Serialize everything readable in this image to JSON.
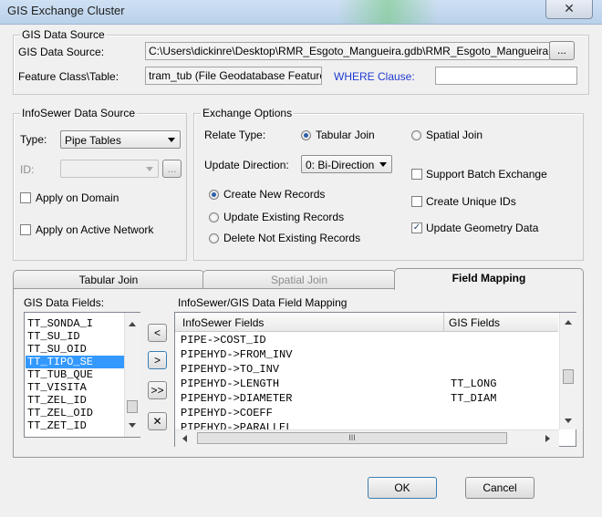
{
  "window": {
    "title": "GIS Exchange Cluster",
    "close": "✕"
  },
  "gis_source": {
    "group_label": "GIS Data Source",
    "data_source_label": "GIS Data Source:",
    "data_source_value": "C:\\Users\\dickinre\\Desktop\\RMR_Esgoto_Mangueira.gdb\\RMR_Esgoto_Mangueira",
    "browse_label": "...",
    "feature_label": "Feature Class\\Table:",
    "feature_value": "tram_tub (File Geodatabase Feature",
    "where_label": "WHERE Clause:",
    "where_value": ""
  },
  "infosewer_source": {
    "group_label": "InfoSewer Data Source",
    "type_label": "Type:",
    "type_value": "Pipe Tables",
    "id_label": "ID:",
    "id_value": "",
    "id_browse": "...",
    "apply_domain": "Apply on Domain",
    "apply_network": "Apply on Active Network"
  },
  "exchange": {
    "group_label": "Exchange Options",
    "relate_label": "Relate Type:",
    "tabular_join": "Tabular Join",
    "spatial_join": "Spatial Join",
    "direction_label": "Update Direction:",
    "direction_value": "0: Bi-Direction",
    "create_new": "Create New Records",
    "update_existing": "Update Existing Records",
    "delete_not_existing": "Delete Not Existing Records",
    "support_batch": "Support Batch Exchange",
    "create_unique": "Create Unique IDs",
    "update_geometry": "Update Geometry Data"
  },
  "tabs": {
    "tabular": "Tabular Join",
    "spatial": "Spatial Join",
    "field_mapping": "Field Mapping"
  },
  "fields": {
    "gis_fields_label": "GIS Data Fields:",
    "items": [
      "TT_SONDA_I",
      "TT_SU_ID",
      "TT_SU_OID",
      "TT_TIPO_SE",
      "TT_TUB_QUE",
      "TT_VISITA",
      "TT_ZEL_ID",
      "TT_ZEL_OID",
      "TT_ZET_ID"
    ],
    "selected_index": 3,
    "move_left": "<",
    "move_right": ">",
    "move_all": ">>",
    "remove": "✕"
  },
  "mapping": {
    "label": "InfoSewer/GIS Data Field Mapping",
    "col_infosewer": "InfoSewer Fields",
    "col_gis": "GIS Fields",
    "rows": [
      {
        "infosewer": "PIPE->COST_ID",
        "gis": ""
      },
      {
        "infosewer": "PIPEHYD->FROM_INV",
        "gis": ""
      },
      {
        "infosewer": "PIPEHYD->TO_INV",
        "gis": ""
      },
      {
        "infosewer": "PIPEHYD->LENGTH",
        "gis": "TT_LONG"
      },
      {
        "infosewer": "PIPEHYD->DIAMETER",
        "gis": "TT_DIAM"
      },
      {
        "infosewer": "PIPEHYD->COEFF",
        "gis": ""
      },
      {
        "infosewer": "PIPEHYD->PARALLEL",
        "gis": ""
      }
    ],
    "hscroll_grip": "III"
  },
  "footer": {
    "ok": "OK",
    "cancel": "Cancel"
  }
}
